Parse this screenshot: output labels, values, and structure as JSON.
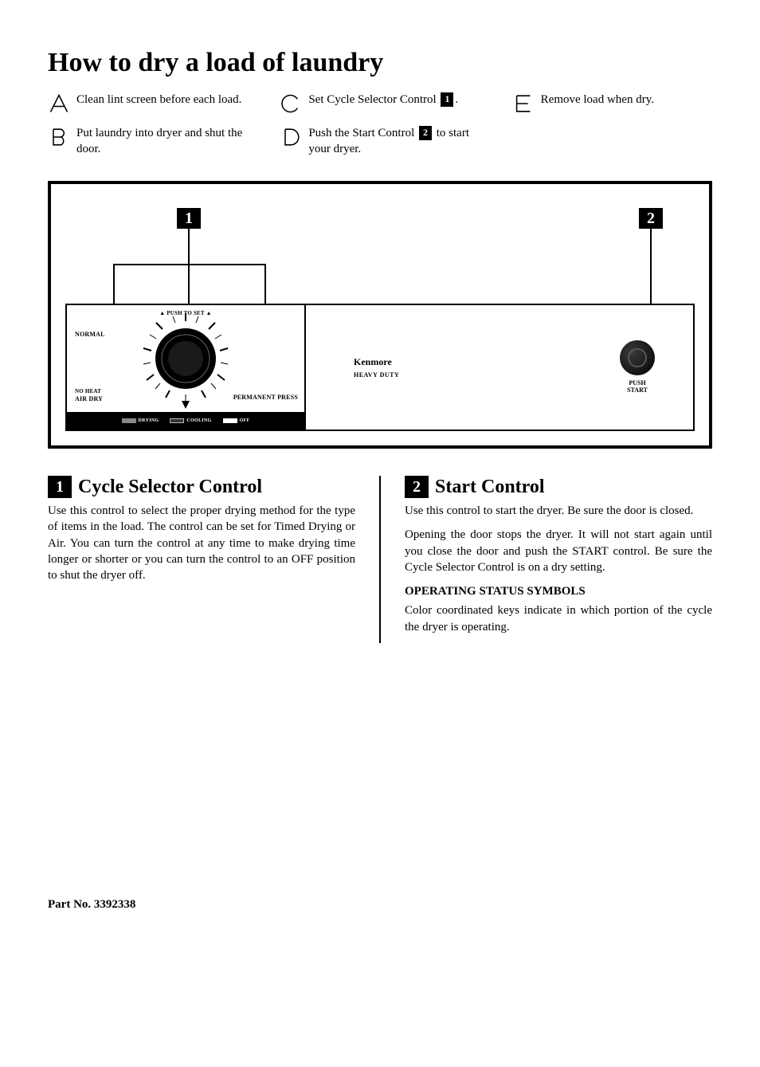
{
  "title": "How to dry a load of laundry",
  "steps": {
    "a": "Clean lint screen before each load.",
    "b": "Put laundry into dryer and shut the door.",
    "c_pre": "Set Cycle Selector Control ",
    "c_ref": "1",
    "c_post": ".",
    "d_pre": "Push the Start Control ",
    "d_ref": "2",
    "d_post": " to start your dryer.",
    "e": "Remove load when dry."
  },
  "panel": {
    "flag1": "1",
    "flag2": "2",
    "dial_top": "▲ PUSH TO SET ▲",
    "dial_left": "NORMAL",
    "dial_bl1": "NO HEAT",
    "dial_bl2": "AIR DRY",
    "dial_br": "PERMANENT PRESS",
    "key_drying": "DRYING",
    "key_cooling": "COOLING",
    "key_off": "OFF",
    "brand": "Kenmore",
    "sub_brand": "HEAVY DUTY",
    "start_push": "PUSH",
    "start_label": "START"
  },
  "controls": {
    "c1_num": "1",
    "c1_title": "Cycle Selector Control",
    "c1_body": "Use this control to select the proper drying method for the type of items in the load. The control can be set for Timed Drying or Air. You can turn the control at any time to make drying time longer or shorter or you can turn the control to an OFF position to shut the dryer off.",
    "c2_num": "2",
    "c2_title": "Start Control",
    "c2_p1": "Use this control to start the dryer. Be sure the door is closed.",
    "c2_p2": "Opening the door stops the dryer. It will not start again until you close the door and push the START control. Be sure the Cycle Selector Control is on a dry setting.",
    "c2_sub": "OPERATING STATUS SYMBOLS",
    "c2_p3": "Color coordinated keys indicate in which portion of the cycle the dryer is operating."
  },
  "footer": "Part No. 3392338"
}
